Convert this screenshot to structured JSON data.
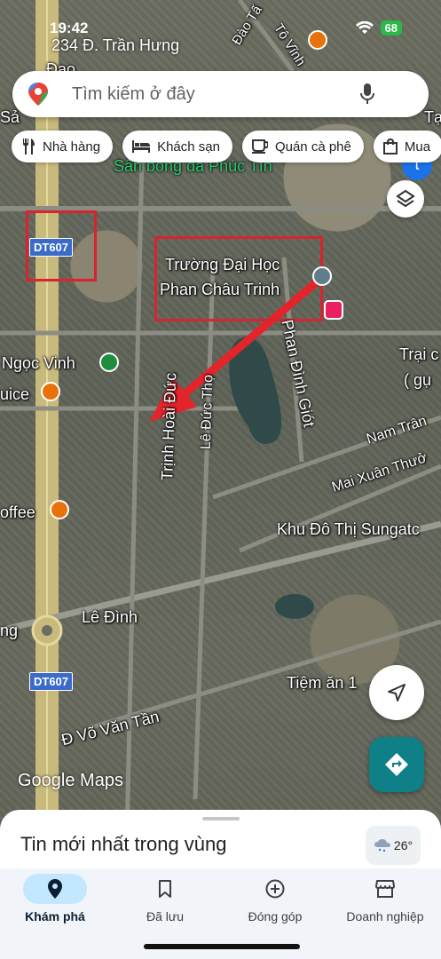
{
  "status_bar": {
    "time": "19:42",
    "battery": "68"
  },
  "address_line": "234 Đ. Trần Hưng",
  "search": {
    "placeholder": "Tìm kiếm ở đây",
    "avatar_letter": "t"
  },
  "chips": [
    {
      "icon": "restaurant-icon",
      "label": "Nhà hàng"
    },
    {
      "icon": "bed-icon",
      "label": "Khách sạn"
    },
    {
      "icon": "coffee-icon",
      "label": "Quán cà phê"
    },
    {
      "icon": "shopping-bag-icon",
      "label": "Mua"
    }
  ],
  "map_labels": {
    "san_bong": "Sân bóng đá Phúc Tín",
    "truong_1": "Trường Đại Học",
    "truong_2": "Phan Châu Trinh",
    "ngoc_vinh": "Ngọc Vinh",
    "uice": "uice",
    "offee": "offee",
    "trinh_hoai_duc": "Trịnh Hoài Đức",
    "le_duc_tho": "Lê Đức Thọ",
    "phan_dinh_giot": "Phan Đình Giót",
    "trai_1": "Trại c",
    "trai_2": "( gụ",
    "nam_tran": "Nam Trân",
    "mai_xuan_thuong": "Mai Xuân Thưở",
    "khu_do_thi": "Khu Đô Thị Sungatc",
    "le_dinh": "Lê Đình",
    "ng": "ng",
    "tiem_an": "Tiệm ăn 1",
    "vo_van_tan": "Đ Võ Văn Tần",
    "dao_tan": "Đào Tấ",
    "to_vinh": "Tô Vĩnh",
    "sa": "Sả",
    "ta": "Tạ",
    "dao": "Đao",
    "road_dt607_1": "DT607",
    "road_dt607_2": "DT607",
    "google_maps": "Google Maps"
  },
  "sheet": {
    "title": "Tin mới nhất trong vùng",
    "weather": "26°"
  },
  "bottom_nav": [
    {
      "icon": "explore-pin-icon",
      "label": "Khám phá",
      "active": true
    },
    {
      "icon": "bookmark-icon",
      "label": "Đã lưu",
      "active": false
    },
    {
      "icon": "add-circle-icon",
      "label": "Đóng góp",
      "active": false
    },
    {
      "icon": "storefront-icon",
      "label": "Doanh nghiệp",
      "active": false
    }
  ],
  "colors": {
    "accent": "#1a73e8",
    "annotation_red": "#d9232f",
    "directions": "#0f7f88",
    "nav_active": "#c2e7ff"
  }
}
